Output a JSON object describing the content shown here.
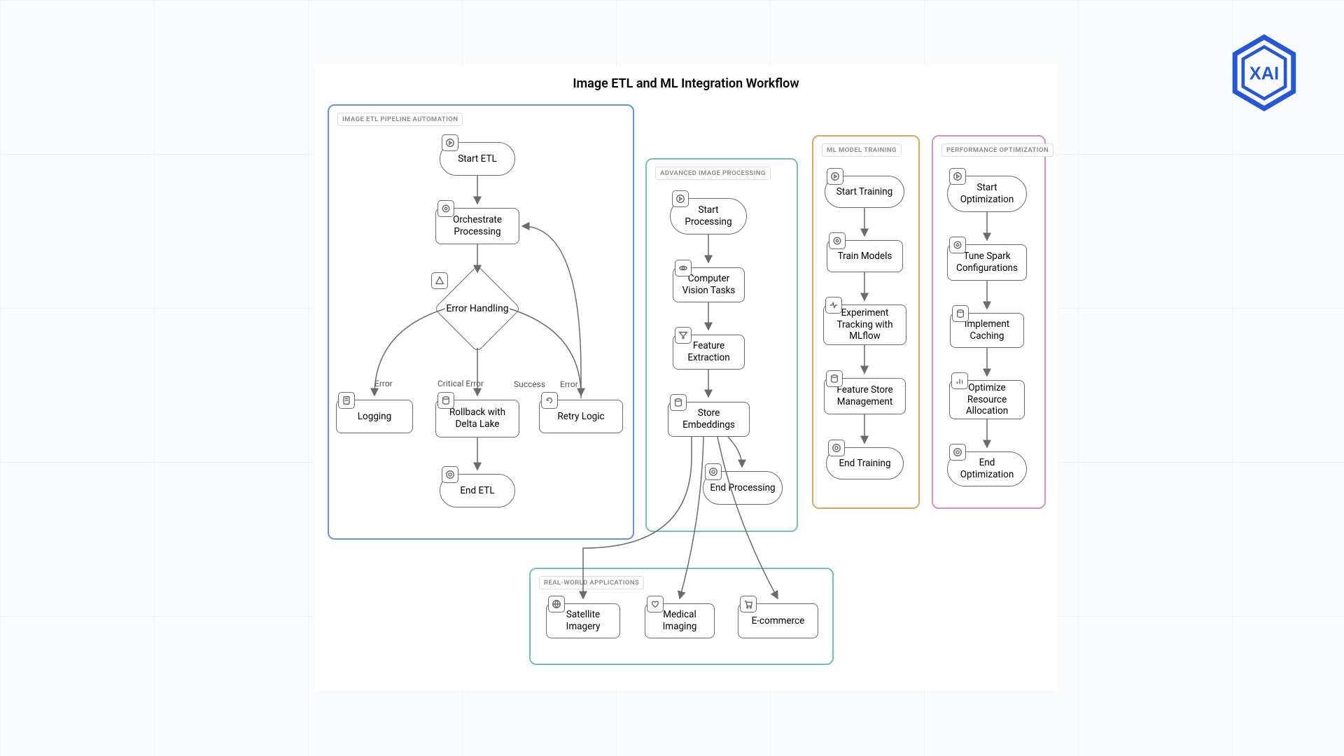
{
  "title": "Image ETL and ML Integration Workflow",
  "colors": {
    "blue": "#6494e8",
    "green": "#77c4a3",
    "orange": "#e0a55a",
    "pink": "#d98fc5",
    "teal": "#6cc0c0"
  },
  "subgraphs": {
    "etl": "IMAGE ETL PIPELINE AUTOMATION",
    "proc": "ADVANCED IMAGE PROCESSING",
    "train": "ML MODEL TRAINING",
    "opt": "PERFORMANCE OPTIMIZATION",
    "apps": "REAL-WORLD APPLICATIONS"
  },
  "nodes": {
    "start_etl": "Start ETL",
    "orchestrate": "Orchestrate Processing",
    "errh": "Error Handling",
    "logging": "Logging",
    "rollback": "Rollback with Delta Lake",
    "retry": "Retry Logic",
    "end_etl": "End ETL",
    "start_proc": "Start Processing",
    "cv": "Computer Vision Tasks",
    "feat": "Feature Extraction",
    "store": "Store Embeddings",
    "end_proc": "End Processing",
    "start_train": "Start Training",
    "train_models": "Train Models",
    "mlflow": "Experiment Tracking with MLflow",
    "fstore": "Feature Store Management",
    "end_train": "End Training",
    "start_opt": "Start Optimization",
    "tune": "Tune Spark Configurations",
    "cache": "Implement Caching",
    "res": "Optimize Resource Allocation",
    "end_opt": "End Optimization",
    "sat": "Satellite Imagery",
    "med": "Medical Imaging",
    "ecom": "E-commerce"
  },
  "edges": {
    "error": "Error",
    "critical": "Critical Error",
    "success": "Success"
  }
}
